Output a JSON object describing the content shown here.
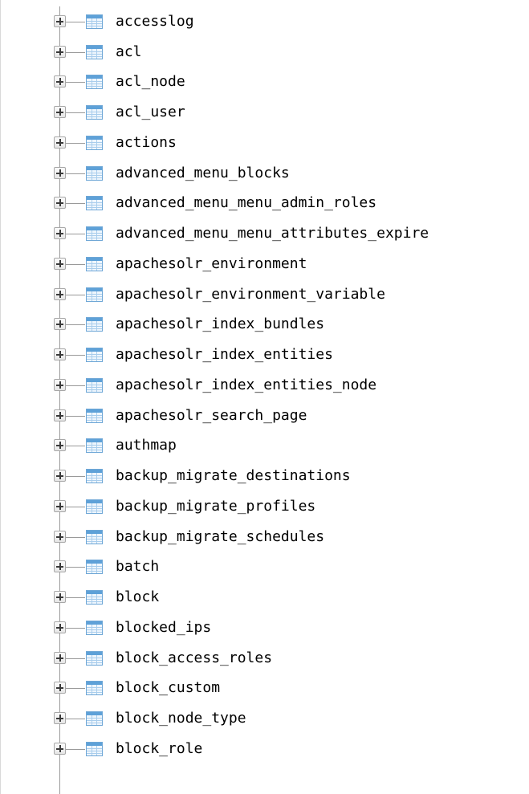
{
  "tree": {
    "items": [
      {
        "label": "accesslog"
      },
      {
        "label": "acl"
      },
      {
        "label": "acl_node"
      },
      {
        "label": "acl_user"
      },
      {
        "label": "actions"
      },
      {
        "label": "advanced_menu_blocks"
      },
      {
        "label": "advanced_menu_menu_admin_roles"
      },
      {
        "label": "advanced_menu_menu_attributes_expire"
      },
      {
        "label": "apachesolr_environment"
      },
      {
        "label": "apachesolr_environment_variable"
      },
      {
        "label": "apachesolr_index_bundles"
      },
      {
        "label": "apachesolr_index_entities"
      },
      {
        "label": "apachesolr_index_entities_node"
      },
      {
        "label": "apachesolr_search_page"
      },
      {
        "label": "authmap"
      },
      {
        "label": "backup_migrate_destinations"
      },
      {
        "label": "backup_migrate_profiles"
      },
      {
        "label": "backup_migrate_schedules"
      },
      {
        "label": "batch"
      },
      {
        "label": "block"
      },
      {
        "label": "blocked_ips"
      },
      {
        "label": "block_access_roles"
      },
      {
        "label": "block_custom"
      },
      {
        "label": "block_node_type"
      },
      {
        "label": "block_role"
      }
    ]
  },
  "icons": {
    "expander": "plus-expander-icon",
    "table": "table-icon"
  },
  "colors": {
    "guide_line": "#9a9a9a",
    "table_icon_header": "#5ea1d8",
    "text": "#000000"
  }
}
